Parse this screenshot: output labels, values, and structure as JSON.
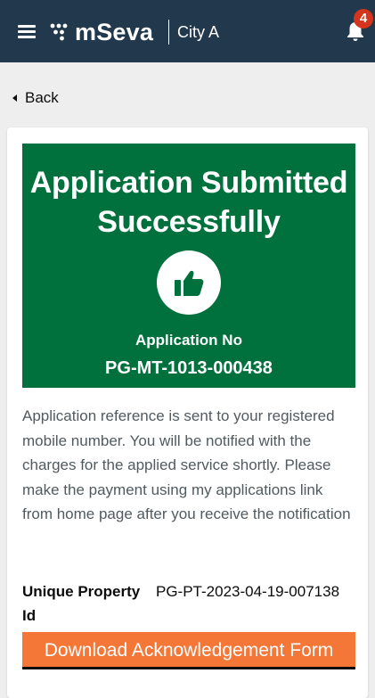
{
  "header": {
    "brand": "mSeva",
    "city": "City A",
    "notification_count": "4",
    "menu_icon": "hamburger-menu-icon",
    "notification_icon": "bell-icon",
    "background_color": "#22394d"
  },
  "nav": {
    "back_label": "Back",
    "back_icon": "caret-left-icon"
  },
  "banner": {
    "title_line1": "Application Submitted",
    "title_line2": "Successfully",
    "icon": "thumbs-up-icon",
    "app_no_label": "Application No",
    "app_no_value": "PG-MT-1013-000438",
    "background_color": "#00703c"
  },
  "message": "Application reference is sent to your registered mobile number. You will be notified with the charges for the applied service shortly. Please make the payment using my applications link from home page after you receive the notification",
  "property": {
    "label": "Unique Property Id",
    "value": "PG-PT-2023-04-19-007138"
  },
  "actions": {
    "download_label": "Download Acknowledgement Form",
    "download_color": "#f47738"
  }
}
